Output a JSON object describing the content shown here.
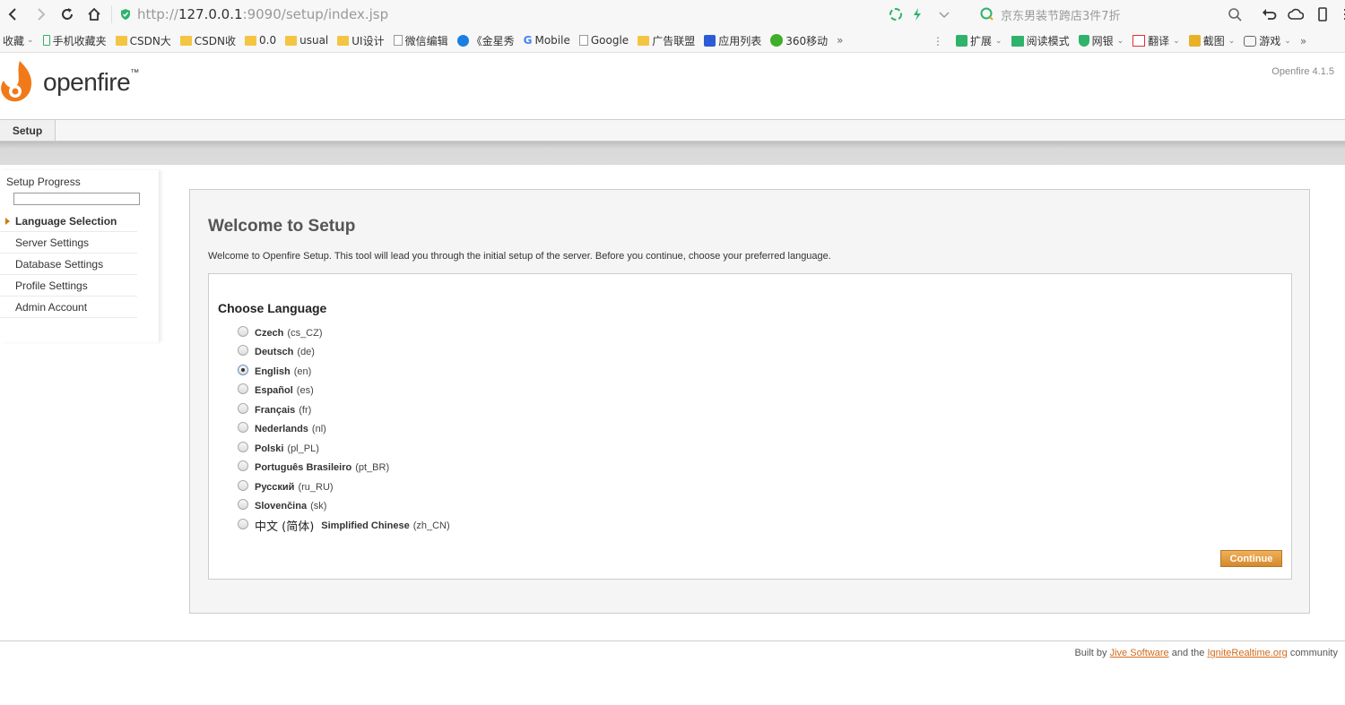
{
  "browser": {
    "url_prefix": "http://",
    "url_host": "127.0.0.1",
    "url_rest": ":9090/setup/index.jsp",
    "search_placeholder": "京东男装节跨店3件7折",
    "bookmarks": [
      {
        "label": "收藏",
        "icon": "none"
      },
      {
        "label": "手机收藏夹",
        "icon": "phone"
      },
      {
        "label": "CSDN大",
        "icon": "folder"
      },
      {
        "label": "CSDN收",
        "icon": "folder"
      },
      {
        "label": "0.0",
        "icon": "folder"
      },
      {
        "label": "usual",
        "icon": "folder"
      },
      {
        "label": "UI设计",
        "icon": "folder"
      },
      {
        "label": "微信编辑",
        "icon": "doc"
      },
      {
        "label": "《金星秀",
        "icon": "play"
      },
      {
        "label": "Mobile",
        "icon": "google"
      },
      {
        "label": "Google",
        "icon": "doc"
      },
      {
        "label": "广告联盟",
        "icon": "folder"
      },
      {
        "label": "应用列表",
        "icon": "baidu"
      },
      {
        "label": "360移动",
        "icon": "360"
      }
    ],
    "more": "»",
    "extensions": [
      {
        "label": "扩展"
      },
      {
        "label": "阅读模式"
      },
      {
        "label": "网银"
      },
      {
        "label": "翻译"
      },
      {
        "label": "截图"
      },
      {
        "label": "游戏"
      }
    ]
  },
  "app": {
    "brand": "openfire",
    "tm": "™",
    "version": "Openfire 4.1.5",
    "tab": "Setup"
  },
  "sidebar": {
    "progress_label": "Setup Progress",
    "progress": 0.0,
    "steps": [
      {
        "label": "Language Selection",
        "active": true
      },
      {
        "label": "Server Settings"
      },
      {
        "label": "Database Settings"
      },
      {
        "label": "Profile Settings"
      },
      {
        "label": "Admin Account"
      }
    ]
  },
  "main": {
    "title": "Welcome to Setup",
    "intro": "Welcome to Openfire Setup. This tool will lead you through the initial setup of the server. Before you continue, choose your preferred language.",
    "choose_title": "Choose Language",
    "languages": [
      {
        "name": "Czech",
        "code": "(cs_CZ)"
      },
      {
        "name": "Deutsch",
        "code": "(de)"
      },
      {
        "name": "English",
        "code": "(en)",
        "checked": true
      },
      {
        "name": "Español",
        "code": "(es)"
      },
      {
        "name": "Français",
        "code": "(fr)"
      },
      {
        "name": "Nederlands",
        "code": "(nl)"
      },
      {
        "name": "Polski",
        "code": "(pl_PL)"
      },
      {
        "name": "Português Brasileiro",
        "code": "(pt_BR)"
      },
      {
        "name": "Русский",
        "code": "(ru_RU)"
      },
      {
        "name": "Slovenčina",
        "code": "(sk)"
      },
      {
        "native": "中文 (简体)",
        "name": "Simplified Chinese",
        "code": "(zh_CN)"
      }
    ],
    "continue": "Continue"
  },
  "footer": {
    "built_by": "Built by",
    "jive": "Jive Software",
    "and_the": "and the",
    "ignite": "IgniteRealtime.org",
    "community": "community"
  }
}
